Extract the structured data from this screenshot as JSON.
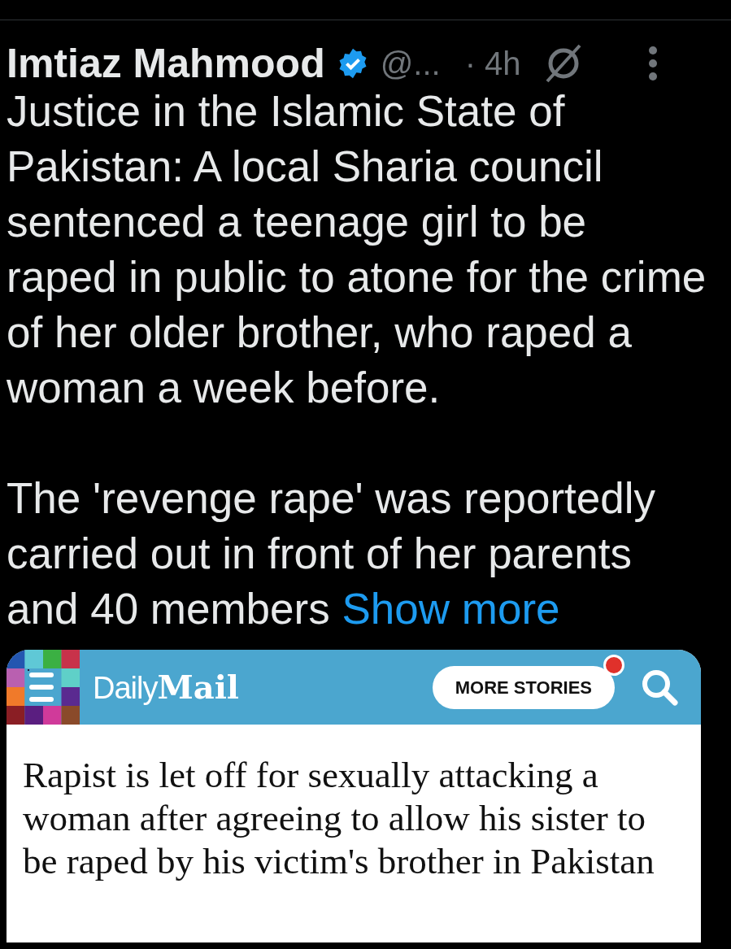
{
  "tweet": {
    "author": "Imtiaz Mahmood",
    "verified": true,
    "handle": "@...",
    "time": "· 4h",
    "paragraphs": [
      "Justice in the Islamic State of Pakistan: A local Sharia council sentenced a teenage girl to be raped in public to atone for the crime of her older brother, who raped a woman a week before.",
      "The 'revenge rape' was reportedly carried out in front of her parents and 40 members"
    ],
    "show_more": "Show more"
  },
  "embedded_page": {
    "logo_left": "Daily",
    "logo_right": "Mail",
    "more_stories": "MORE STORIES",
    "notification": true,
    "headline": "Rapist is let off for sexually attacking a woman after agreeing to allow his sister to be raped by his victim's brother in Pakistan"
  }
}
